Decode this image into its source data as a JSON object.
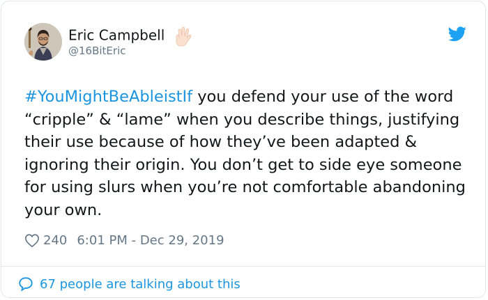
{
  "author": {
    "name": "Eric Campbell",
    "handle": "@16BitEric"
  },
  "tweet": {
    "hashtag": "#YouMightBeAbleistIf",
    "text": " you defend your use of the word “cripple” & “lame” when you describe things, justifying their use because of how they’ve been adapted & ignoring their origin. You don’t get to side eye someone for using slurs when you’re not comfortable abandoning your own."
  },
  "meta": {
    "likes": "240",
    "timestamp": "6:01 PM - Dec 29, 2019"
  },
  "footer": {
    "conversation": "67 people are talking about this"
  },
  "icons": {
    "emoji": "vulcan-salute-icon",
    "logo": "twitter-bird-icon",
    "like": "heart-icon",
    "reply": "speech-bubble-icon"
  },
  "colors": {
    "link": "#1b95e0",
    "muted": "#657786",
    "text": "#14171a",
    "border": "#e1e8ed"
  }
}
